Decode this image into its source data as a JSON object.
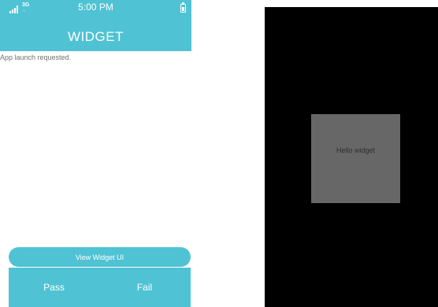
{
  "status_bar": {
    "network": "3G",
    "network_sub": "↓↑",
    "time": "5:00 PM",
    "signal_icon": "signal-bars-icon",
    "battery_icon": "battery-icon"
  },
  "app": {
    "title": "WIDGET",
    "log": "App launch requested."
  },
  "buttons": {
    "view_widget": "View Widget UI",
    "pass": "Pass",
    "fail": "Fail"
  },
  "widget": {
    "text": "Hello widget"
  },
  "colors": {
    "accent": "#4fc3d4",
    "widget_bg": "#676767",
    "screen_bg": "#000000"
  }
}
